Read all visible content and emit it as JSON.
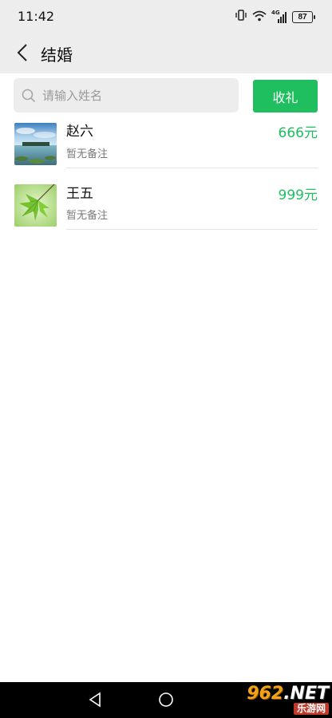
{
  "status": {
    "time": "11:42",
    "battery": "87",
    "signal_label": "4G"
  },
  "header": {
    "title": "结婚"
  },
  "search": {
    "placeholder": "请输入姓名",
    "value": ""
  },
  "actions": {
    "gift_label": "收礼"
  },
  "records": [
    {
      "name": "赵六",
      "note": "暂无备注",
      "amount": "666元",
      "avatar_icon": "lake-landscape-image"
    },
    {
      "name": "王五",
      "note": "暂无备注",
      "amount": "999元",
      "avatar_icon": "green-leaves-image"
    }
  ],
  "watermark": {
    "brand_number": "962",
    "brand_suffix": ".NET",
    "brand_sub": "乐游网"
  },
  "colors": {
    "accent": "#1fbf5f",
    "background": "#ededed",
    "text_secondary": "#7a7a7a"
  }
}
